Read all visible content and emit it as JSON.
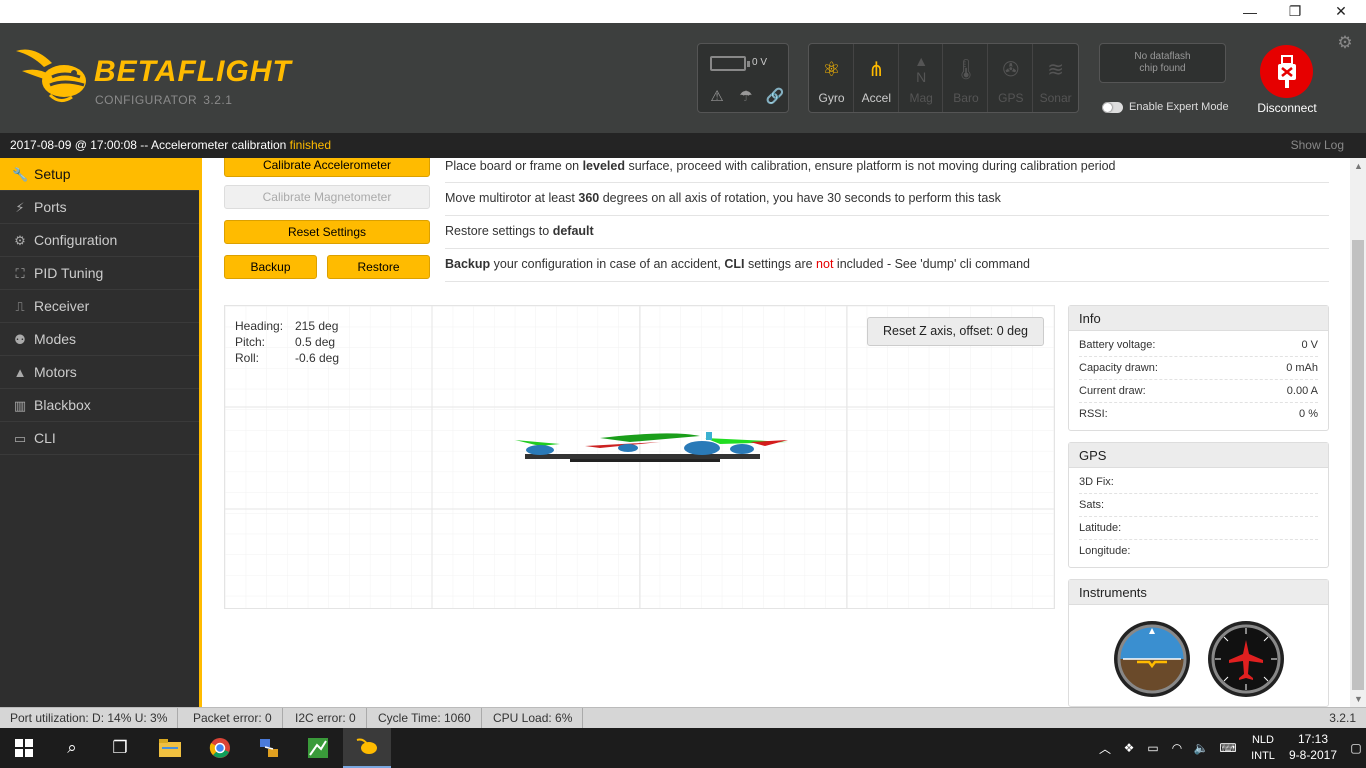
{
  "window": {
    "min": "—",
    "restore": "❐",
    "close": "✕"
  },
  "app": {
    "name": "BETAFLIGHT",
    "sub": "CONFIGURATOR",
    "version": "3.2.1"
  },
  "battery": {
    "voltage": "0 V"
  },
  "sensors": [
    {
      "label": "Gyro",
      "icon": "gyro-icon",
      "active": true
    },
    {
      "label": "Accel",
      "icon": "accel-icon",
      "active": true
    },
    {
      "label": "Mag",
      "icon": "mag-icon",
      "active": false
    },
    {
      "label": "Baro",
      "icon": "baro-icon",
      "active": false
    },
    {
      "label": "GPS",
      "icon": "gps-icon",
      "active": false
    },
    {
      "label": "Sonar",
      "icon": "sonar-icon",
      "active": false
    }
  ],
  "dataflash": {
    "line1": "No dataflash",
    "line2": "chip found"
  },
  "expert_mode": {
    "label": "Enable Expert Mode",
    "on": false
  },
  "disconnect": {
    "label": "Disconnect"
  },
  "log": {
    "prefix": "2017-08-09 @ 17:00:08 -- Accelerometer calibration ",
    "status": "finished",
    "show_log": "Show Log"
  },
  "nav": [
    {
      "label": "Setup",
      "icon": "wrench-icon",
      "active": true
    },
    {
      "label": "Ports",
      "icon": "plug-icon"
    },
    {
      "label": "Configuration",
      "icon": "gear-icon"
    },
    {
      "label": "PID Tuning",
      "icon": "pid-icon"
    },
    {
      "label": "Receiver",
      "icon": "receiver-icon"
    },
    {
      "label": "Modes",
      "icon": "modes-icon"
    },
    {
      "label": "Motors",
      "icon": "motor-icon"
    },
    {
      "label": "Blackbox",
      "icon": "blackbox-icon"
    },
    {
      "label": "CLI",
      "icon": "terminal-icon"
    }
  ],
  "setup": {
    "calibrate_accel": "Calibrate Accelerometer",
    "calibrate_accel_text": {
      "a": "Place board or frame on ",
      "b": "leveled",
      "c": " surface, proceed with calibration, ensure platform is not moving during calibration period"
    },
    "calibrate_mag": "Calibrate Magnetometer",
    "calibrate_mag_text": {
      "a": "Move multirotor at least ",
      "b": "360",
      "c": " degrees on all axis of rotation, you have 30 seconds to perform this task"
    },
    "reset_settings": "Reset Settings",
    "reset_text": {
      "a": "Restore settings to ",
      "b": "default"
    },
    "backup": "Backup",
    "restore": "Restore",
    "backup_text": {
      "a": "Backup",
      "b": " your configuration in case of an accident, ",
      "c": "CLI",
      "d": " settings are ",
      "e": "not",
      "f": " included - See 'dump' cli command"
    }
  },
  "attitude": {
    "heading_label": "Heading:",
    "heading": "215 deg",
    "pitch_label": "Pitch:",
    "pitch": "0.5 deg",
    "roll_label": "Roll:",
    "roll": "-0.6 deg"
  },
  "reset_z": "Reset Z axis, offset: 0 deg",
  "info": {
    "title": "Info",
    "rows": [
      {
        "k": "Battery voltage:",
        "v": "0 V"
      },
      {
        "k": "Capacity drawn:",
        "v": "0 mAh"
      },
      {
        "k": "Current draw:",
        "v": "0.00 A"
      },
      {
        "k": "RSSI:",
        "v": "0 %"
      }
    ]
  },
  "gps": {
    "title": "GPS",
    "rows": [
      {
        "k": "3D Fix:",
        "v": ""
      },
      {
        "k": "Sats:",
        "v": ""
      },
      {
        "k": "Latitude:",
        "v": ""
      },
      {
        "k": "Longitude:",
        "v": ""
      }
    ]
  },
  "instruments": {
    "title": "Instruments"
  },
  "status": {
    "port": "Port utilization: D: 14% U: 3%",
    "packet": "Packet error: 0",
    "i2c": "I2C error: 0",
    "cycle": "Cycle Time: 1060",
    "cpu": "CPU Load: 6%",
    "version": "3.2.1"
  },
  "taskbar": {
    "lang1": "NLD",
    "lang2": "INTL",
    "time": "17:13",
    "date": "9-8-2017"
  },
  "colors": {
    "accent": "#ffbb00",
    "header": "#3d3f3e",
    "disconnect": "#e60000"
  }
}
